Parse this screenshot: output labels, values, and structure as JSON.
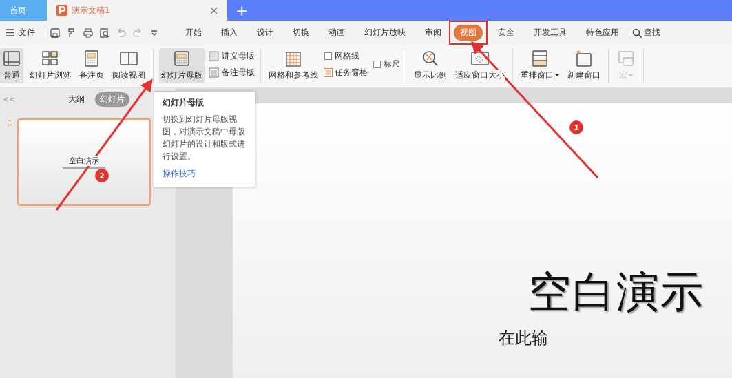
{
  "window_tabs": [
    {
      "label": "首页",
      "kind": "home",
      "selected": false
    },
    {
      "label": "演示文稿1",
      "kind": "document",
      "selected": true
    }
  ],
  "new_tab": "+",
  "menu": {
    "file": "文件",
    "tabs": [
      {
        "label": "开始",
        "selected": false
      },
      {
        "label": "插入",
        "selected": false
      },
      {
        "label": "设计",
        "selected": false
      },
      {
        "label": "切换",
        "selected": false
      },
      {
        "label": "动画",
        "selected": false
      },
      {
        "label": "幻灯片放映",
        "selected": false
      },
      {
        "label": "审阅",
        "selected": false
      },
      {
        "label": "视图",
        "selected": true
      },
      {
        "label": "安全",
        "selected": false
      },
      {
        "label": "开发工具",
        "selected": false
      },
      {
        "label": "特色应用",
        "selected": false
      }
    ],
    "search": "查找"
  },
  "ribbon": [
    [
      {
        "kind": "large",
        "label": "普通",
        "pressed": true,
        "disabled": false,
        "dropdown": false
      },
      {
        "kind": "large",
        "label": "幻灯片浏览",
        "pressed": false,
        "disabled": false,
        "dropdown": false
      },
      {
        "kind": "large",
        "label": "备注页",
        "pressed": false,
        "disabled": false,
        "dropdown": false
      },
      {
        "kind": "large",
        "label": "阅读视图",
        "pressed": false,
        "disabled": false,
        "dropdown": false
      }
    ],
    [
      {
        "kind": "large",
        "label": "幻灯片母版",
        "pressed": true,
        "disabled": false,
        "dropdown": false
      },
      {
        "kind": "small",
        "label": "讲义母版"
      },
      {
        "kind": "small",
        "label": "备注母版"
      }
    ],
    [
      {
        "kind": "large",
        "label": "网格和参考线",
        "pressed": false,
        "disabled": false,
        "dropdown": false
      },
      {
        "kind": "checkbox",
        "label": "网格线",
        "checked": false
      },
      {
        "kind": "checkbox",
        "label": "任务窗格",
        "checked": true
      },
      {
        "kind": "checkbox",
        "label": "标尺",
        "checked": false
      }
    ],
    [
      {
        "kind": "large",
        "label": "显示比例",
        "pressed": false,
        "disabled": false,
        "dropdown": false
      },
      {
        "kind": "large",
        "label": "适应窗口大小",
        "pressed": false,
        "disabled": false,
        "dropdown": false
      }
    ],
    [
      {
        "kind": "large",
        "label": "重排窗口",
        "pressed": false,
        "disabled": false,
        "dropdown": true
      },
      {
        "kind": "large",
        "label": "新建窗口",
        "pressed": false,
        "disabled": false,
        "dropdown": false
      }
    ],
    [
      {
        "kind": "large",
        "label": "宏",
        "pressed": false,
        "disabled": true,
        "dropdown": true
      }
    ]
  ],
  "side_panel": {
    "collapse": "<<",
    "tabs": [
      {
        "label": "大纲",
        "selected": false
      },
      {
        "label": "幻灯片",
        "selected": true
      }
    ],
    "slides": [
      {
        "number": "1",
        "title": "空白演示",
        "selected": true
      }
    ]
  },
  "tooltip": {
    "title": "幻灯片母版",
    "text": "切换到幻灯片母版视图，对演示文稿中母版幻灯片的设计和版式进行设置。",
    "link": "操作技巧"
  },
  "slide": {
    "title": "空白演示",
    "subtitle": "在此输"
  },
  "annotations": [
    {
      "label": "1"
    },
    {
      "label": "2"
    }
  ]
}
